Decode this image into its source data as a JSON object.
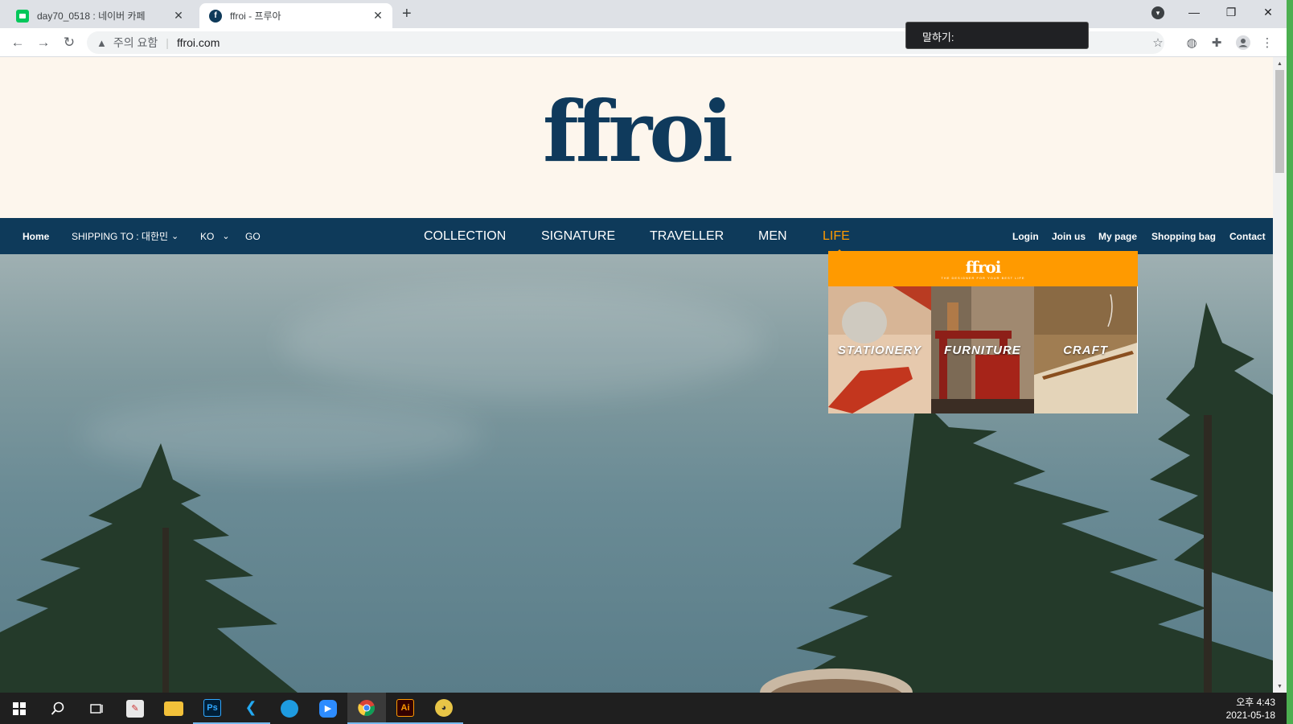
{
  "browser": {
    "tabs": [
      {
        "title": "day70_0518 : 네이버 카페",
        "active": false,
        "favicon_color": "#03c75a"
      },
      {
        "title": "ffroi - 프루아",
        "active": true,
        "favicon_color": "#0e3a5a"
      }
    ],
    "new_tab": "+",
    "address": {
      "warning": "주의 요함",
      "url": "ffroi.com"
    },
    "speech_popup": "말하기:"
  },
  "site": {
    "logo": "ffroi",
    "nav_left": {
      "home": "Home",
      "shipping": "SHIPPING TO : 대한민",
      "language": "KO",
      "go": "GO"
    },
    "nav_center": [
      "COLLECTION",
      "SIGNATURE",
      "TRAVELLER",
      "MEN",
      "LIFE"
    ],
    "active_nav": "LIFE",
    "nav_right": [
      "Login",
      "Join us",
      "My page",
      "Shopping bag",
      "Contact"
    ],
    "dropdown": {
      "logo": "ffroi",
      "tagline": "THE DESIGNER FOR YOUR BEST LIFE",
      "cards": [
        "STATIONERY",
        "FURNITURE",
        "CRAFT"
      ]
    }
  },
  "colors": {
    "navy": "#0e3a5a",
    "accent_orange": "#ff9a00",
    "header_bg": "#fdf6ed"
  },
  "taskbar": {
    "apps": [
      "windows-start",
      "search",
      "task-view",
      "paint",
      "file-explorer",
      "photoshop",
      "vscode",
      "edge",
      "zoom",
      "chrome",
      "illustrator",
      "app"
    ],
    "time": "오후 4:43",
    "date": "2021-05-18"
  }
}
